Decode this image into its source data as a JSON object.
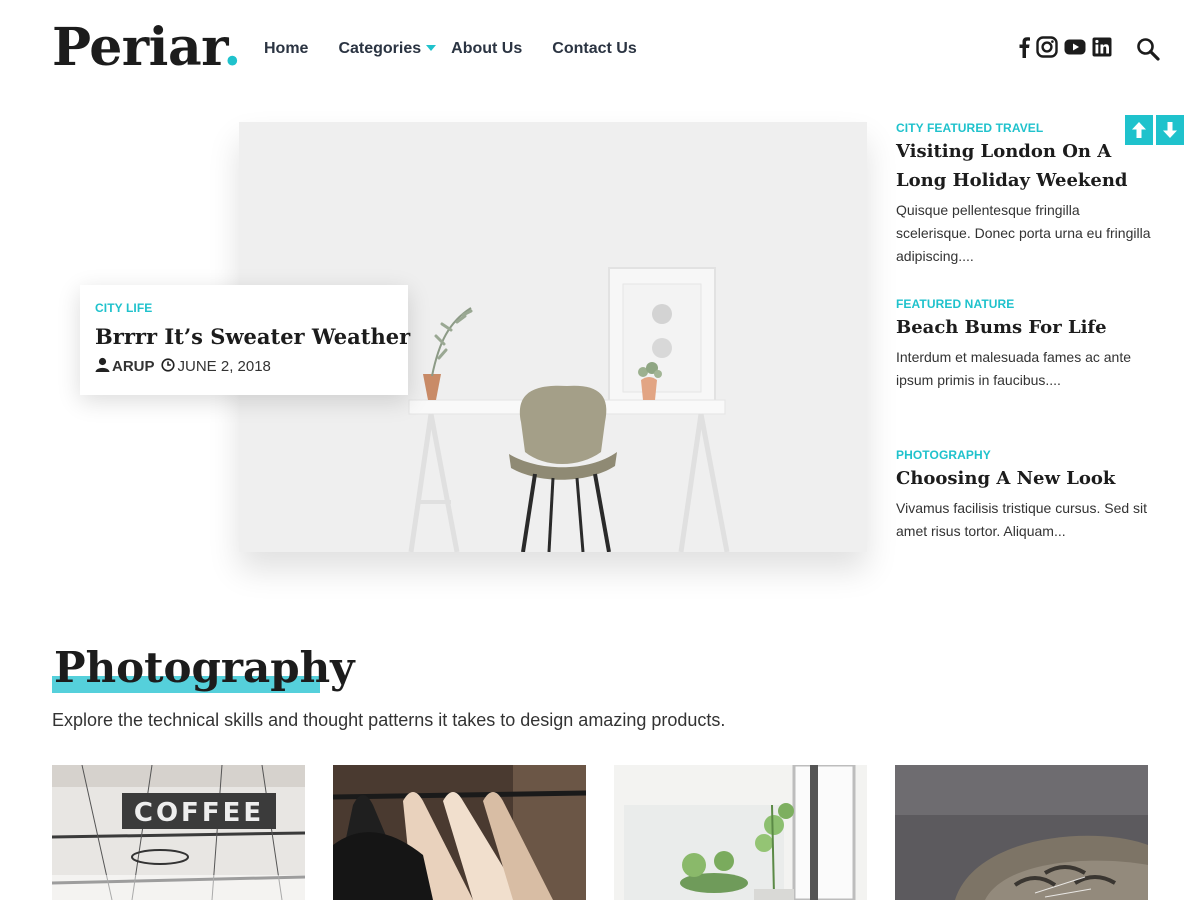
{
  "header": {
    "logo_text": "Periar",
    "logo_dot": ".",
    "nav": [
      {
        "label": "Home"
      },
      {
        "label": "Categories"
      },
      {
        "label": "About Us"
      },
      {
        "label": "Contact Us"
      }
    ],
    "social_icons": [
      "facebook-icon",
      "instagram-icon",
      "youtube-icon",
      "linkedin-icon"
    ],
    "search_icon": "search-icon"
  },
  "colors": {
    "accent": "#1fc2cc",
    "highlight": "#55d0db",
    "text": "#1c1c1c"
  },
  "hero": {
    "category": "CITY LIFE",
    "title": "Brrrr It’s Sweater Weather",
    "author": "ARUP",
    "date": "JUNE 2, 2018"
  },
  "side_posts": [
    {
      "category": "CITY FEATURED TRAVEL",
      "title": "Visiting London On A Long Holiday Weekend",
      "excerpt": "Quisque pellentesque fringilla scelerisque. Donec porta urna eu fringilla adipiscing...."
    },
    {
      "category": "FEATURED NATURE",
      "title": "Beach Bums For Life",
      "excerpt": "Interdum et malesuada fames ac ante ipsum primis in faucibus...."
    },
    {
      "category": "PHOTOGRAPHY",
      "title": "Choosing A New Look",
      "excerpt": "Vivamus facilisis tristique cursus. Sed sit amet risus tortor. Aliquam..."
    }
  ],
  "section": {
    "title": "Photography",
    "description": "Explore the technical skills and thought patterns it takes to design amazing products.",
    "coffee_sign": "COFFEE"
  }
}
